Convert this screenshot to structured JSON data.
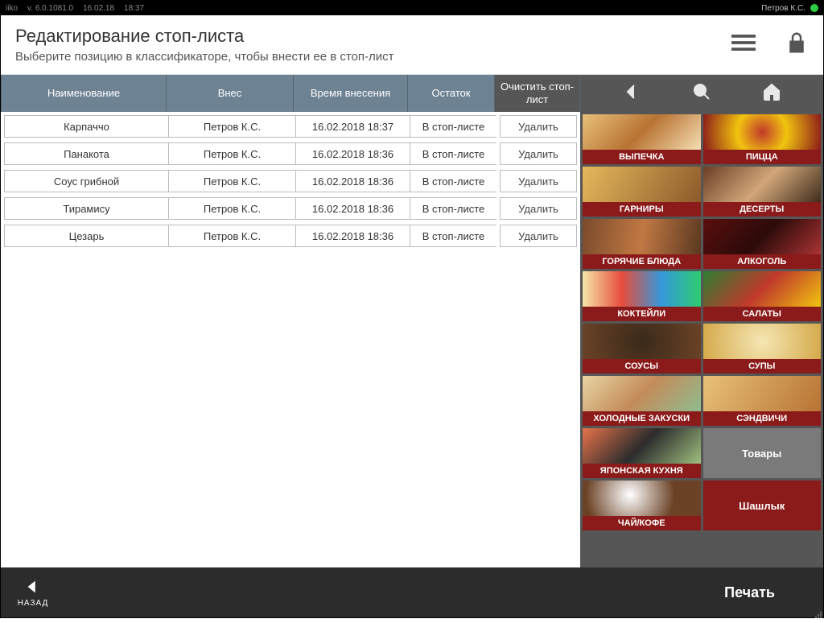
{
  "topbar": {
    "app": "iiko",
    "version": "v. 6.0.1081.0",
    "date": "16.02.18",
    "time": "18:37",
    "user": "Петров К.С."
  },
  "header": {
    "title": "Редактирование стоп-листа",
    "subtitle": "Выберите позицию в классификаторе, чтобы внести ее в стоп-лист"
  },
  "columns": {
    "name": "Наименование",
    "user": "Внес",
    "time": "Время внесения",
    "status": "Остаток",
    "clear": "Очистить стоп-лист"
  },
  "rows": [
    {
      "name": "Карпаччо",
      "user": "Петров К.С.",
      "time": "16.02.2018 18:37",
      "status": "В стоп-листе",
      "del": "Удалить"
    },
    {
      "name": "Панакота",
      "user": "Петров К.С.",
      "time": "16.02.2018 18:36",
      "status": "В стоп-листе",
      "del": "Удалить"
    },
    {
      "name": "Соус грибной",
      "user": "Петров К.С.",
      "time": "16.02.2018 18:36",
      "status": "В стоп-листе",
      "del": "Удалить"
    },
    {
      "name": "Тирамису",
      "user": "Петров К.С.",
      "time": "16.02.2018 18:36",
      "status": "В стоп-листе",
      "del": "Удалить"
    },
    {
      "name": "Цезарь",
      "user": "Петров К.С.",
      "time": "16.02.2018 18:36",
      "status": "В стоп-листе",
      "del": "Удалить"
    }
  ],
  "categories": [
    {
      "label": "ВЫПЕЧКА",
      "img": "i0"
    },
    {
      "label": "ПИЦЦА",
      "img": "i1"
    },
    {
      "label": "ГАРНИРЫ",
      "img": "i2"
    },
    {
      "label": "ДЕСЕРТЫ",
      "img": "i3"
    },
    {
      "label": "ГОРЯЧИЕ БЛЮДА",
      "img": "i4"
    },
    {
      "label": "АЛКОГОЛЬ",
      "img": "i5"
    },
    {
      "label": "КОКТЕЙЛИ",
      "img": "i6"
    },
    {
      "label": "САЛАТЫ",
      "img": "i7"
    },
    {
      "label": "СОУСЫ",
      "img": "i8"
    },
    {
      "label": "СУПЫ",
      "img": "i9"
    },
    {
      "label": "ХОЛОДНЫЕ ЗАКУСКИ",
      "img": "i10"
    },
    {
      "label": "СЭНДВИЧИ",
      "img": "i11"
    },
    {
      "label": "ЯПОНСКАЯ КУХНЯ",
      "img": "i12"
    },
    {
      "label": "Товары",
      "style": "gray"
    },
    {
      "label": "ЧАЙ/КОФЕ",
      "img": "i13"
    },
    {
      "label": "Шашлык",
      "style": "darkred"
    }
  ],
  "footer": {
    "back": "НАЗАД",
    "print": "Печать"
  }
}
